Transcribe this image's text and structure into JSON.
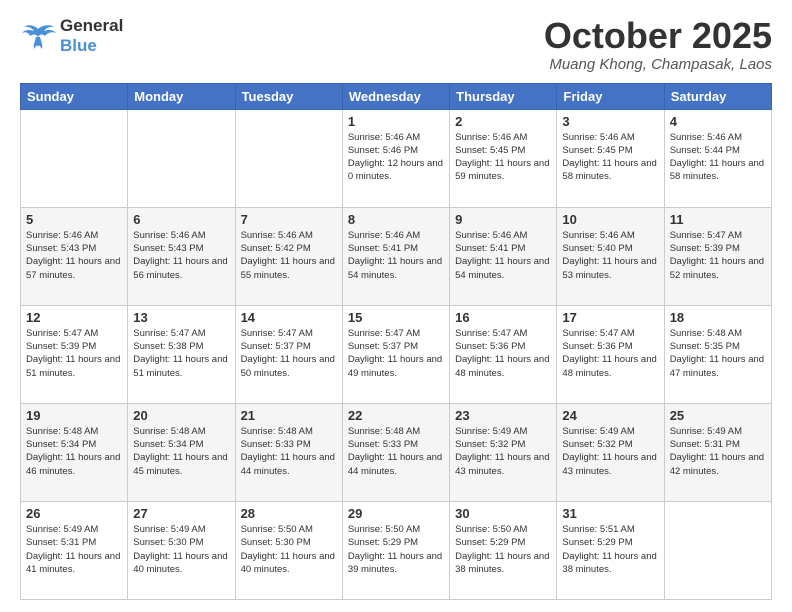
{
  "logo": {
    "line1": "General",
    "line2": "Blue"
  },
  "header": {
    "title": "October 2025",
    "subtitle": "Muang Khong, Champasak, Laos"
  },
  "weekdays": [
    "Sunday",
    "Monday",
    "Tuesday",
    "Wednesday",
    "Thursday",
    "Friday",
    "Saturday"
  ],
  "weeks": [
    [
      {
        "day": "",
        "sunrise": "",
        "sunset": "",
        "daylight": ""
      },
      {
        "day": "",
        "sunrise": "",
        "sunset": "",
        "daylight": ""
      },
      {
        "day": "",
        "sunrise": "",
        "sunset": "",
        "daylight": ""
      },
      {
        "day": "1",
        "sunrise": "Sunrise: 5:46 AM",
        "sunset": "Sunset: 5:46 PM",
        "daylight": "Daylight: 12 hours and 0 minutes."
      },
      {
        "day": "2",
        "sunrise": "Sunrise: 5:46 AM",
        "sunset": "Sunset: 5:45 PM",
        "daylight": "Daylight: 11 hours and 59 minutes."
      },
      {
        "day": "3",
        "sunrise": "Sunrise: 5:46 AM",
        "sunset": "Sunset: 5:45 PM",
        "daylight": "Daylight: 11 hours and 58 minutes."
      },
      {
        "day": "4",
        "sunrise": "Sunrise: 5:46 AM",
        "sunset": "Sunset: 5:44 PM",
        "daylight": "Daylight: 11 hours and 58 minutes."
      }
    ],
    [
      {
        "day": "5",
        "sunrise": "Sunrise: 5:46 AM",
        "sunset": "Sunset: 5:43 PM",
        "daylight": "Daylight: 11 hours and 57 minutes."
      },
      {
        "day": "6",
        "sunrise": "Sunrise: 5:46 AM",
        "sunset": "Sunset: 5:43 PM",
        "daylight": "Daylight: 11 hours and 56 minutes."
      },
      {
        "day": "7",
        "sunrise": "Sunrise: 5:46 AM",
        "sunset": "Sunset: 5:42 PM",
        "daylight": "Daylight: 11 hours and 55 minutes."
      },
      {
        "day": "8",
        "sunrise": "Sunrise: 5:46 AM",
        "sunset": "Sunset: 5:41 PM",
        "daylight": "Daylight: 11 hours and 54 minutes."
      },
      {
        "day": "9",
        "sunrise": "Sunrise: 5:46 AM",
        "sunset": "Sunset: 5:41 PM",
        "daylight": "Daylight: 11 hours and 54 minutes."
      },
      {
        "day": "10",
        "sunrise": "Sunrise: 5:46 AM",
        "sunset": "Sunset: 5:40 PM",
        "daylight": "Daylight: 11 hours and 53 minutes."
      },
      {
        "day": "11",
        "sunrise": "Sunrise: 5:47 AM",
        "sunset": "Sunset: 5:39 PM",
        "daylight": "Daylight: 11 hours and 52 minutes."
      }
    ],
    [
      {
        "day": "12",
        "sunrise": "Sunrise: 5:47 AM",
        "sunset": "Sunset: 5:39 PM",
        "daylight": "Daylight: 11 hours and 51 minutes."
      },
      {
        "day": "13",
        "sunrise": "Sunrise: 5:47 AM",
        "sunset": "Sunset: 5:38 PM",
        "daylight": "Daylight: 11 hours and 51 minutes."
      },
      {
        "day": "14",
        "sunrise": "Sunrise: 5:47 AM",
        "sunset": "Sunset: 5:37 PM",
        "daylight": "Daylight: 11 hours and 50 minutes."
      },
      {
        "day": "15",
        "sunrise": "Sunrise: 5:47 AM",
        "sunset": "Sunset: 5:37 PM",
        "daylight": "Daylight: 11 hours and 49 minutes."
      },
      {
        "day": "16",
        "sunrise": "Sunrise: 5:47 AM",
        "sunset": "Sunset: 5:36 PM",
        "daylight": "Daylight: 11 hours and 48 minutes."
      },
      {
        "day": "17",
        "sunrise": "Sunrise: 5:47 AM",
        "sunset": "Sunset: 5:36 PM",
        "daylight": "Daylight: 11 hours and 48 minutes."
      },
      {
        "day": "18",
        "sunrise": "Sunrise: 5:48 AM",
        "sunset": "Sunset: 5:35 PM",
        "daylight": "Daylight: 11 hours and 47 minutes."
      }
    ],
    [
      {
        "day": "19",
        "sunrise": "Sunrise: 5:48 AM",
        "sunset": "Sunset: 5:34 PM",
        "daylight": "Daylight: 11 hours and 46 minutes."
      },
      {
        "day": "20",
        "sunrise": "Sunrise: 5:48 AM",
        "sunset": "Sunset: 5:34 PM",
        "daylight": "Daylight: 11 hours and 45 minutes."
      },
      {
        "day": "21",
        "sunrise": "Sunrise: 5:48 AM",
        "sunset": "Sunset: 5:33 PM",
        "daylight": "Daylight: 11 hours and 44 minutes."
      },
      {
        "day": "22",
        "sunrise": "Sunrise: 5:48 AM",
        "sunset": "Sunset: 5:33 PM",
        "daylight": "Daylight: 11 hours and 44 minutes."
      },
      {
        "day": "23",
        "sunrise": "Sunrise: 5:49 AM",
        "sunset": "Sunset: 5:32 PM",
        "daylight": "Daylight: 11 hours and 43 minutes."
      },
      {
        "day": "24",
        "sunrise": "Sunrise: 5:49 AM",
        "sunset": "Sunset: 5:32 PM",
        "daylight": "Daylight: 11 hours and 43 minutes."
      },
      {
        "day": "25",
        "sunrise": "Sunrise: 5:49 AM",
        "sunset": "Sunset: 5:31 PM",
        "daylight": "Daylight: 11 hours and 42 minutes."
      }
    ],
    [
      {
        "day": "26",
        "sunrise": "Sunrise: 5:49 AM",
        "sunset": "Sunset: 5:31 PM",
        "daylight": "Daylight: 11 hours and 41 minutes."
      },
      {
        "day": "27",
        "sunrise": "Sunrise: 5:49 AM",
        "sunset": "Sunset: 5:30 PM",
        "daylight": "Daylight: 11 hours and 40 minutes."
      },
      {
        "day": "28",
        "sunrise": "Sunrise: 5:50 AM",
        "sunset": "Sunset: 5:30 PM",
        "daylight": "Daylight: 11 hours and 40 minutes."
      },
      {
        "day": "29",
        "sunrise": "Sunrise: 5:50 AM",
        "sunset": "Sunset: 5:29 PM",
        "daylight": "Daylight: 11 hours and 39 minutes."
      },
      {
        "day": "30",
        "sunrise": "Sunrise: 5:50 AM",
        "sunset": "Sunset: 5:29 PM",
        "daylight": "Daylight: 11 hours and 38 minutes."
      },
      {
        "day": "31",
        "sunrise": "Sunrise: 5:51 AM",
        "sunset": "Sunset: 5:29 PM",
        "daylight": "Daylight: 11 hours and 38 minutes."
      },
      {
        "day": "",
        "sunrise": "",
        "sunset": "",
        "daylight": ""
      }
    ]
  ]
}
